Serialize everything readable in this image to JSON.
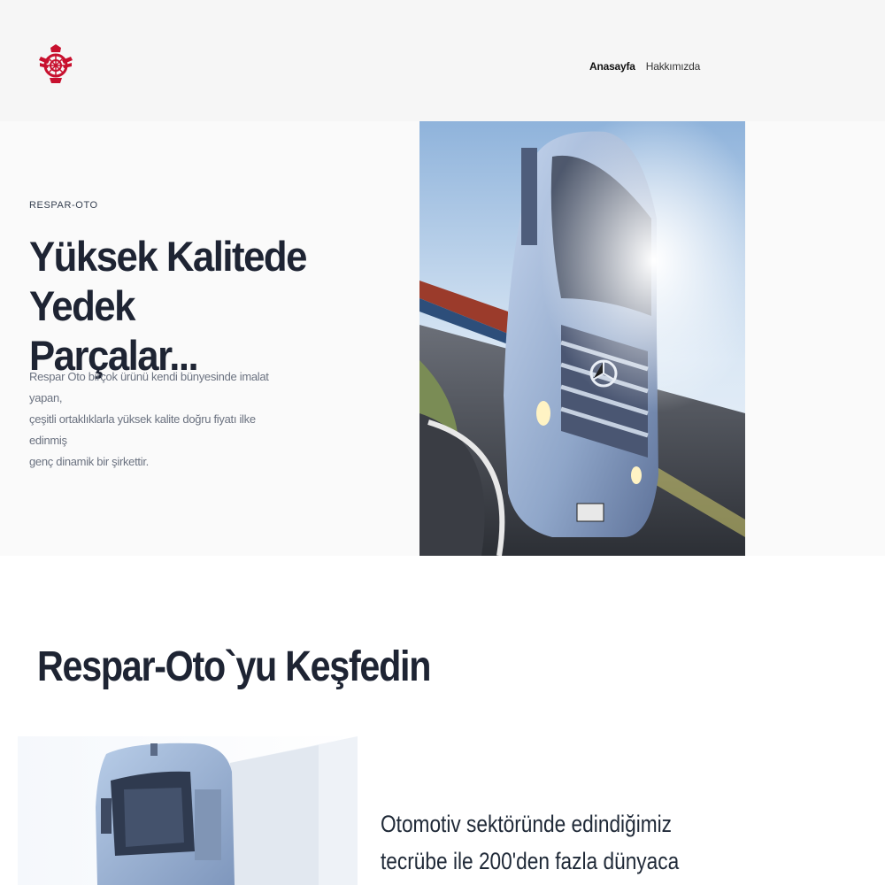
{
  "header": {
    "logo_icon": "respar-oto-emblem-icon",
    "nav": [
      {
        "label": "Anasayfa",
        "active": true
      },
      {
        "label": "Hakkımızda",
        "active": false
      }
    ]
  },
  "hero": {
    "eyebrow": "RESPAR-OTO",
    "title_line1": "Yüksek Kalitede Yedek",
    "title_line2": "Parçalar...",
    "description_line1": "Respar Oto birçok ürünü kendi bünyesinde imalat yapan,",
    "description_line2": "çeşitli ortaklıklarla yüksek kalite doğru fiyatı ilke edinmiş",
    "description_line3": "genç dinamik bir şirkettir.",
    "image_icon": "truck-photo"
  },
  "discover": {
    "title": "Respar-Oto`yu Keşfedin",
    "text_line1": "Otomotiv sektöründe edindiğimiz",
    "text_line2": "tecrübe ile 200'den fazla dünyaca",
    "image_icon": "truck-photo"
  },
  "colors": {
    "brand_red": "#c8102e",
    "heading": "#1e2433",
    "header_bg": "#f6f6f6"
  }
}
